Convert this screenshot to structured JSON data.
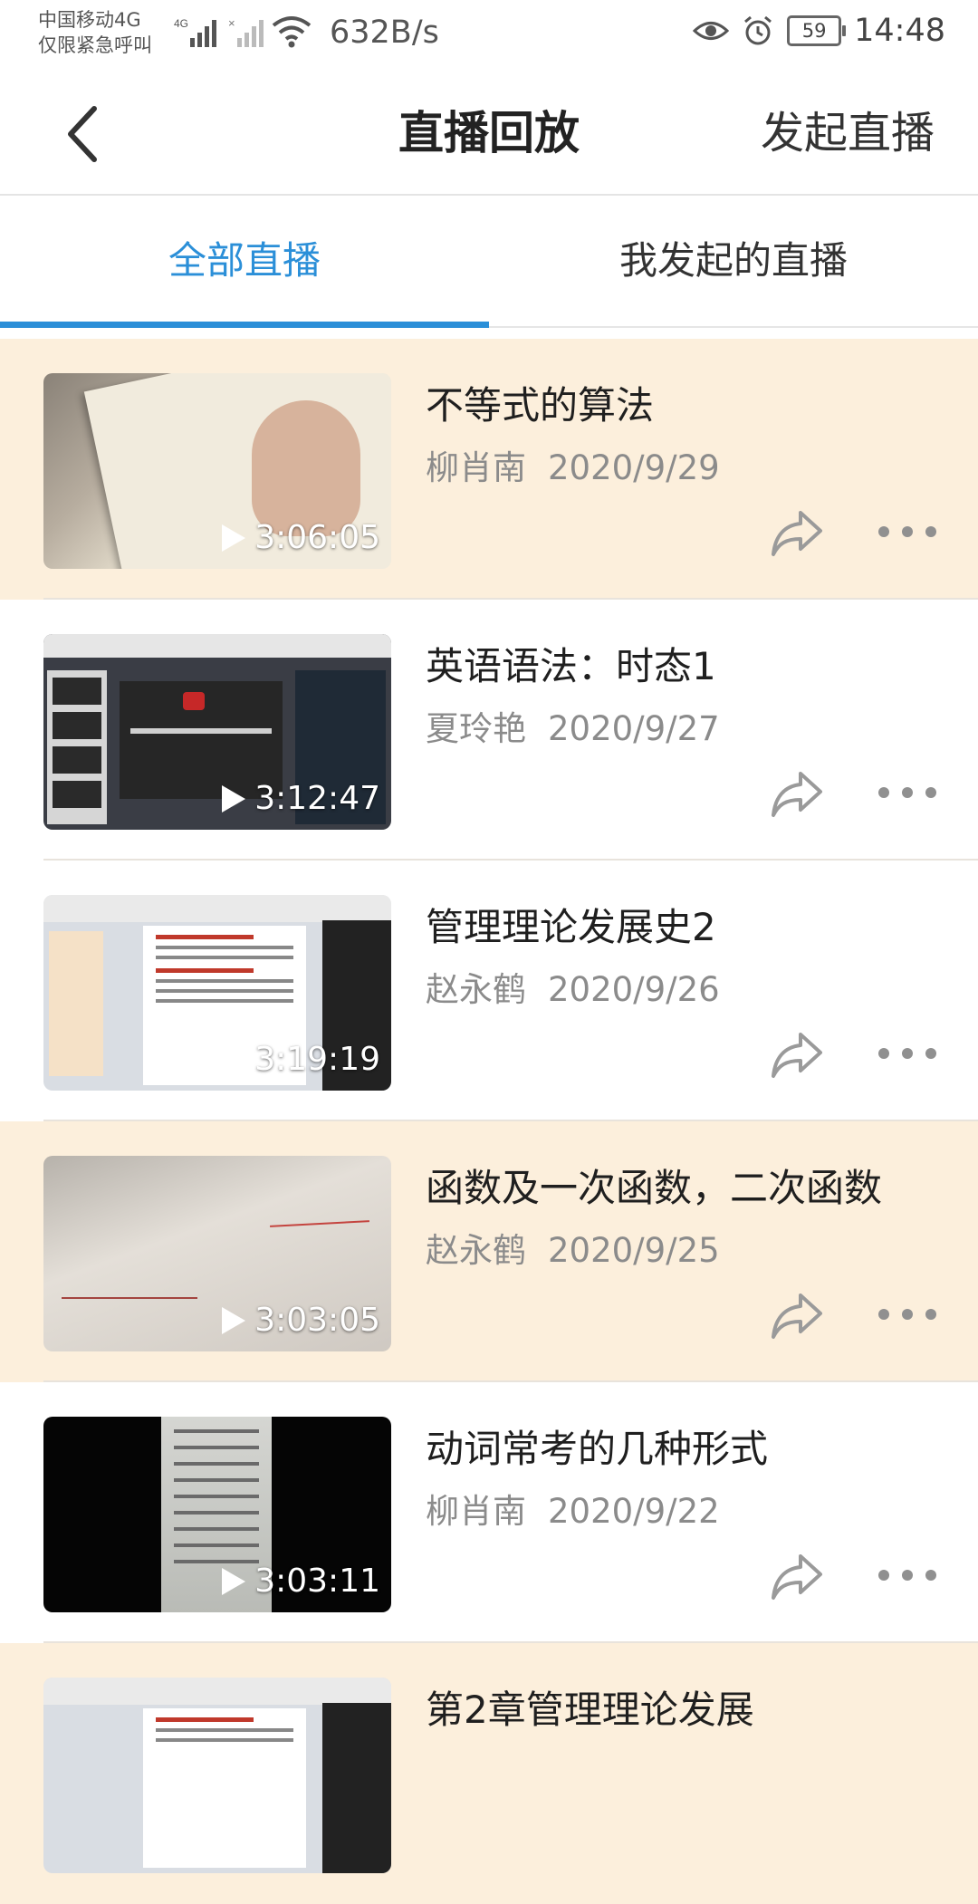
{
  "status_bar": {
    "carrier_line1": "中国移动4G",
    "carrier_line2": "仅限紧急呼叫",
    "network_badge": "4G",
    "net_speed": "632B/s",
    "battery": "59",
    "time": "14:48",
    "icons": [
      "signal-icon",
      "no-signal-icon",
      "wifi-icon",
      "eye-icon",
      "alarm-icon",
      "battery-icon"
    ]
  },
  "navbar": {
    "back_icon": "chevron-left-icon",
    "title": "直播回放",
    "action": "发起直播"
  },
  "tabs": [
    {
      "label": "全部直播",
      "active": true
    },
    {
      "label": "我发起的直播",
      "active": false
    }
  ],
  "colors": {
    "accent": "#2b8fd8",
    "highlight_row": "#fcefdc"
  },
  "items": [
    {
      "title": "不等式的算法",
      "author": "柳肖南",
      "date": "2020/9/29",
      "duration": "3:06:05",
      "highlighted": true
    },
    {
      "title": "英语语法：时态1",
      "author": "夏玲艳",
      "date": "2020/9/27",
      "duration": "3:12:47",
      "highlighted": false
    },
    {
      "title": "管理理论发展史2",
      "author": "赵永鹤",
      "date": "2020/9/26",
      "duration": "3:19:19",
      "highlighted": false
    },
    {
      "title": "函数及一次函数，二次函数",
      "author": "赵永鹤",
      "date": "2020/9/25",
      "duration": "3:03:05",
      "highlighted": true
    },
    {
      "title": "动词常考的几种形式",
      "author": "柳肖南",
      "date": "2020/9/22",
      "duration": "3:03:11",
      "highlighted": false
    },
    {
      "title": "第2章管理理论发展",
      "highlighted": true
    }
  ]
}
